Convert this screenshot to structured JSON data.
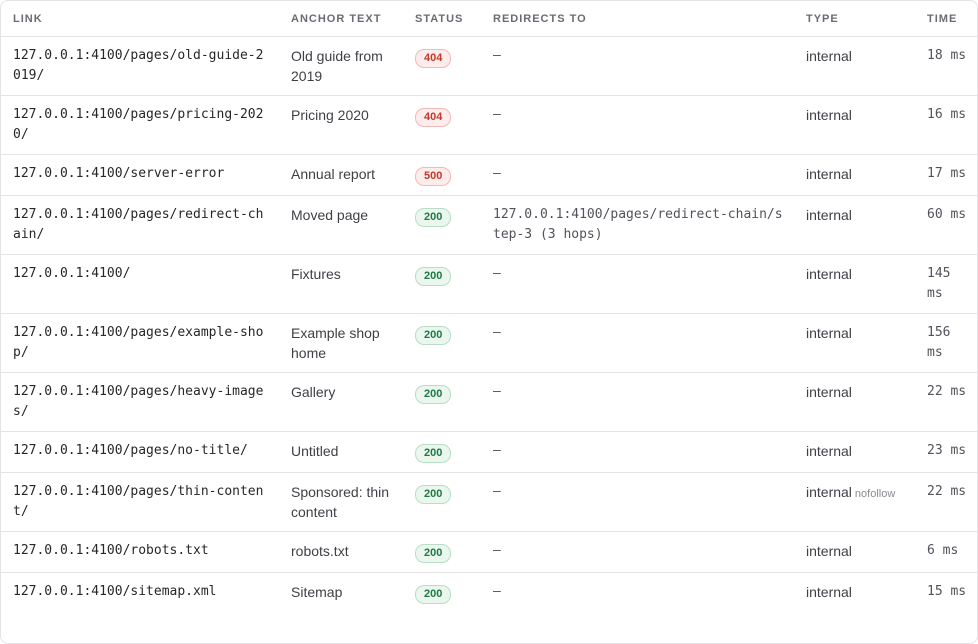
{
  "headers": {
    "link": "LINK",
    "anchor": "ANCHOR TEXT",
    "status": "STATUS",
    "redirects": "REDIRECTS TO",
    "type": "TYPE",
    "time": "TIME"
  },
  "colors": {
    "error_badge": "#c0392b",
    "ok_badge": "#1e7a45",
    "border": "#e4e4e7"
  },
  "rows": [
    {
      "link": "127.0.0.1:4100/pages/old-guide-2019/",
      "anchor": "Old guide from 2019",
      "status": "404",
      "redirect": "—",
      "type": "internal",
      "flag": "",
      "time": "18 ms"
    },
    {
      "link": "127.0.0.1:4100/pages/pricing-2020/",
      "anchor": "Pricing 2020",
      "status": "404",
      "redirect": "—",
      "type": "internal",
      "flag": "",
      "time": "16 ms"
    },
    {
      "link": "127.0.0.1:4100/server-error",
      "anchor": "Annual report",
      "status": "500",
      "redirect": "—",
      "type": "internal",
      "flag": "",
      "time": "17 ms"
    },
    {
      "link": "127.0.0.1:4100/pages/redirect-chain/",
      "anchor": "Moved page",
      "status": "200",
      "redirect": "127.0.0.1:4100/pages/redirect-chain/step-3 (3 hops)",
      "type": "internal",
      "flag": "",
      "time": "60 ms"
    },
    {
      "link": "127.0.0.1:4100/",
      "anchor": "Fixtures",
      "status": "200",
      "redirect": "—",
      "type": "internal",
      "flag": "",
      "time": "145 ms"
    },
    {
      "link": "127.0.0.1:4100/pages/example-shop/",
      "anchor": "Example shop home",
      "status": "200",
      "redirect": "—",
      "type": "internal",
      "flag": "",
      "time": "156 ms"
    },
    {
      "link": "127.0.0.1:4100/pages/heavy-images/",
      "anchor": "Gallery",
      "status": "200",
      "redirect": "—",
      "type": "internal",
      "flag": "",
      "time": "22 ms"
    },
    {
      "link": "127.0.0.1:4100/pages/no-title/",
      "anchor": "Untitled",
      "status": "200",
      "redirect": "—",
      "type": "internal",
      "flag": "",
      "time": "23 ms"
    },
    {
      "link": "127.0.0.1:4100/pages/thin-content/",
      "anchor": "Sponsored: thin content",
      "status": "200",
      "redirect": "—",
      "type": "internal",
      "flag": "nofollow",
      "time": "22 ms"
    },
    {
      "link": "127.0.0.1:4100/robots.txt",
      "anchor": "robots.txt",
      "status": "200",
      "redirect": "—",
      "type": "internal",
      "flag": "",
      "time": "6 ms"
    },
    {
      "link": "127.0.0.1:4100/sitemap.xml",
      "anchor": "Sitemap",
      "status": "200",
      "redirect": "—",
      "type": "internal",
      "flag": "",
      "time": "15 ms"
    }
  ]
}
